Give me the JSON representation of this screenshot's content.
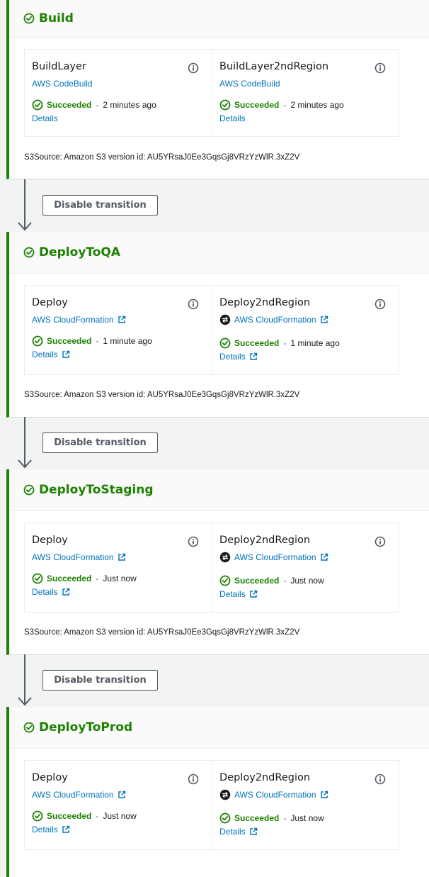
{
  "stages": [
    {
      "title": "Build",
      "actions": [
        {
          "name": "BuildLayer",
          "provider": "AWS CodeBuild",
          "status": "Succeeded",
          "time": "2 minutes ago",
          "details": "Details"
        },
        {
          "name": "BuildLayer2ndRegion",
          "provider": "AWS CodeBuild",
          "status": "Succeeded",
          "time": "2 minutes ago",
          "details": "Details"
        }
      ],
      "source": "S3Source: Amazon S3 version id: AU5YRsaJ0Ee3GqsGj8VRzYzWlR.3xZ2V"
    },
    {
      "title": "DeployToQA",
      "actions": [
        {
          "name": "Deploy",
          "provider": "AWS CloudFormation",
          "status": "Succeeded",
          "time": "1 minute ago",
          "details": "Details"
        },
        {
          "name": "Deploy2ndRegion",
          "provider": "AWS CloudFormation",
          "status": "Succeeded",
          "time": "1 minute ago",
          "details": "Details"
        }
      ],
      "source": "S3Source: Amazon S3 version id: AU5YRsaJ0Ee3GqsGj8VRzYzWlR.3xZ2V"
    },
    {
      "title": "DeployToStaging",
      "actions": [
        {
          "name": "Deploy",
          "provider": "AWS CloudFormation",
          "status": "Succeeded",
          "time": "Just now",
          "details": "Details"
        },
        {
          "name": "Deploy2ndRegion",
          "provider": "AWS CloudFormation",
          "status": "Succeeded",
          "time": "Just now",
          "details": "Details"
        }
      ],
      "source": "S3Source: Amazon S3 version id: AU5YRsaJ0Ee3GqsGj8VRzYzWlR.3xZ2V"
    },
    {
      "title": "DeployToProd",
      "actions": [
        {
          "name": "Deploy",
          "provider": "AWS CloudFormation",
          "status": "Succeeded",
          "time": "Just now",
          "details": "Details"
        },
        {
          "name": "Deploy2ndRegion",
          "provider": "AWS CloudFormation",
          "status": "Succeeded",
          "time": "Just now",
          "details": "Details"
        }
      ]
    }
  ],
  "transitions": [
    {
      "label": "Disable transition"
    },
    {
      "label": "Disable transition"
    },
    {
      "label": "Disable transition"
    }
  ],
  "icons": {
    "status": "check-circle-icon",
    "info": "info-icon",
    "external": "external-link-icon",
    "cross_region": "cross-region-icon"
  },
  "colors": {
    "success": "#1d8102",
    "link": "#0073bb",
    "text": "#16191f",
    "muted": "#545b64"
  }
}
